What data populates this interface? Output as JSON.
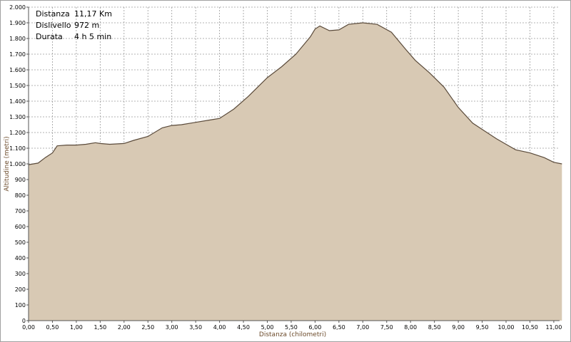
{
  "chart_data": {
    "type": "area",
    "xlabel": "Distanza (chilometri)",
    "ylabel": "Altitudine (metri)",
    "xlim": [
      0,
      11.17
    ],
    "ylim": [
      0,
      2000
    ],
    "x_tick_labels": [
      "0,00",
      "0,50",
      "1,00",
      "1,50",
      "2,00",
      "2,50",
      "3,00",
      "3,50",
      "4,00",
      "4,50",
      "5,00",
      "5,50",
      "6,00",
      "6,50",
      "7,00",
      "7,50",
      "8,00",
      "8,50",
      "9,00",
      "9,50",
      "10,00",
      "10,50",
      "11,00"
    ],
    "y_tick_labels": [
      "0",
      "100",
      "200",
      "300",
      "400",
      "500",
      "600",
      "700",
      "800",
      "900",
      "1.000",
      "1.100",
      "1.200",
      "1.300",
      "1.400",
      "1.500",
      "1.600",
      "1.700",
      "1.800",
      "1.900",
      "2.000"
    ],
    "grid": true,
    "area_fill": "#d8c9b4",
    "area_stroke": "#5a4a3a",
    "series": [
      {
        "x": [
          0.0,
          0.2,
          0.35,
          0.5,
          0.6,
          0.8,
          1.0,
          1.2,
          1.4,
          1.5,
          1.7,
          2.0,
          2.2,
          2.5,
          2.8,
          3.0,
          3.2,
          3.5,
          3.8,
          4.0,
          4.3,
          4.6,
          5.0,
          5.3,
          5.6,
          5.9,
          6.0,
          6.1,
          6.3,
          6.5,
          6.7,
          7.0,
          7.3,
          7.6,
          7.9,
          8.1,
          8.4,
          8.7,
          9.0,
          9.3,
          9.5,
          9.8,
          10.0,
          10.2,
          10.5,
          10.8,
          11.0,
          11.17
        ],
        "y": [
          995,
          1005,
          1040,
          1070,
          1115,
          1120,
          1120,
          1125,
          1135,
          1130,
          1125,
          1130,
          1150,
          1175,
          1230,
          1245,
          1250,
          1265,
          1280,
          1290,
          1350,
          1430,
          1550,
          1620,
          1700,
          1810,
          1860,
          1880,
          1850,
          1855,
          1890,
          1900,
          1890,
          1840,
          1730,
          1660,
          1580,
          1490,
          1360,
          1260,
          1220,
          1160,
          1125,
          1090,
          1070,
          1040,
          1010,
          1000
        ]
      }
    ]
  },
  "info": {
    "distance_label": "Distanza",
    "distance_value": "11,17 Km",
    "elevation_label": "Dislivello",
    "elevation_value": "972 m",
    "duration_label": "Durata",
    "duration_value": "4 h   5 min"
  }
}
